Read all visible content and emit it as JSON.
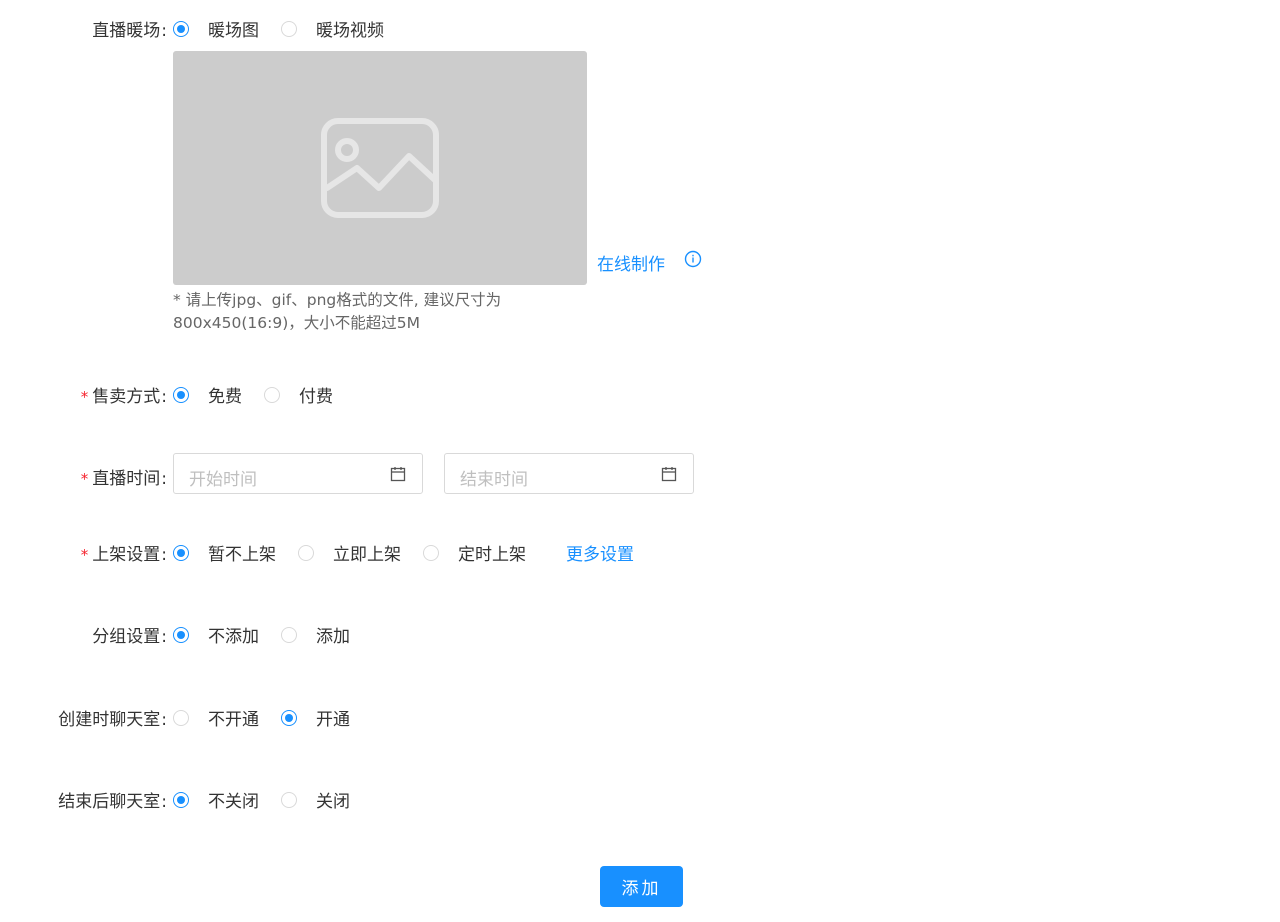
{
  "warmup": {
    "label": "直播暖场",
    "options": [
      "暖场图",
      "暖场视频"
    ],
    "selected": 0,
    "online_make": "在线制作",
    "hint_line1": "* 请上传jpg、gif、png格式的文件, 建议尺寸为",
    "hint_line2": "800x450(16:9)，大小不能超过5M"
  },
  "sale": {
    "label": "售卖方式",
    "required": "*",
    "options": [
      "免费",
      "付费"
    ],
    "selected": 0
  },
  "live_time": {
    "label": "直播时间",
    "required": "*",
    "start_placeholder": "开始时间",
    "end_placeholder": "结束时间"
  },
  "shelf": {
    "label": "上架设置",
    "required": "*",
    "options": [
      "暂不上架",
      "立即上架",
      "定时上架"
    ],
    "selected": 0,
    "more": "更多设置"
  },
  "group": {
    "label": "分组设置",
    "options": [
      "不添加",
      "添加"
    ],
    "selected": 0
  },
  "chat_create": {
    "label": "创建时聊天室",
    "options": [
      "不开通",
      "开通"
    ],
    "selected": 1
  },
  "chat_end": {
    "label": "结束后聊天室",
    "options": [
      "不关闭",
      "关闭"
    ],
    "selected": 0
  },
  "colon": ":",
  "submit": "添加",
  "colors": {
    "primary": "#1890ff",
    "required": "#f5222d",
    "placeholder_bg": "#cccccc"
  }
}
